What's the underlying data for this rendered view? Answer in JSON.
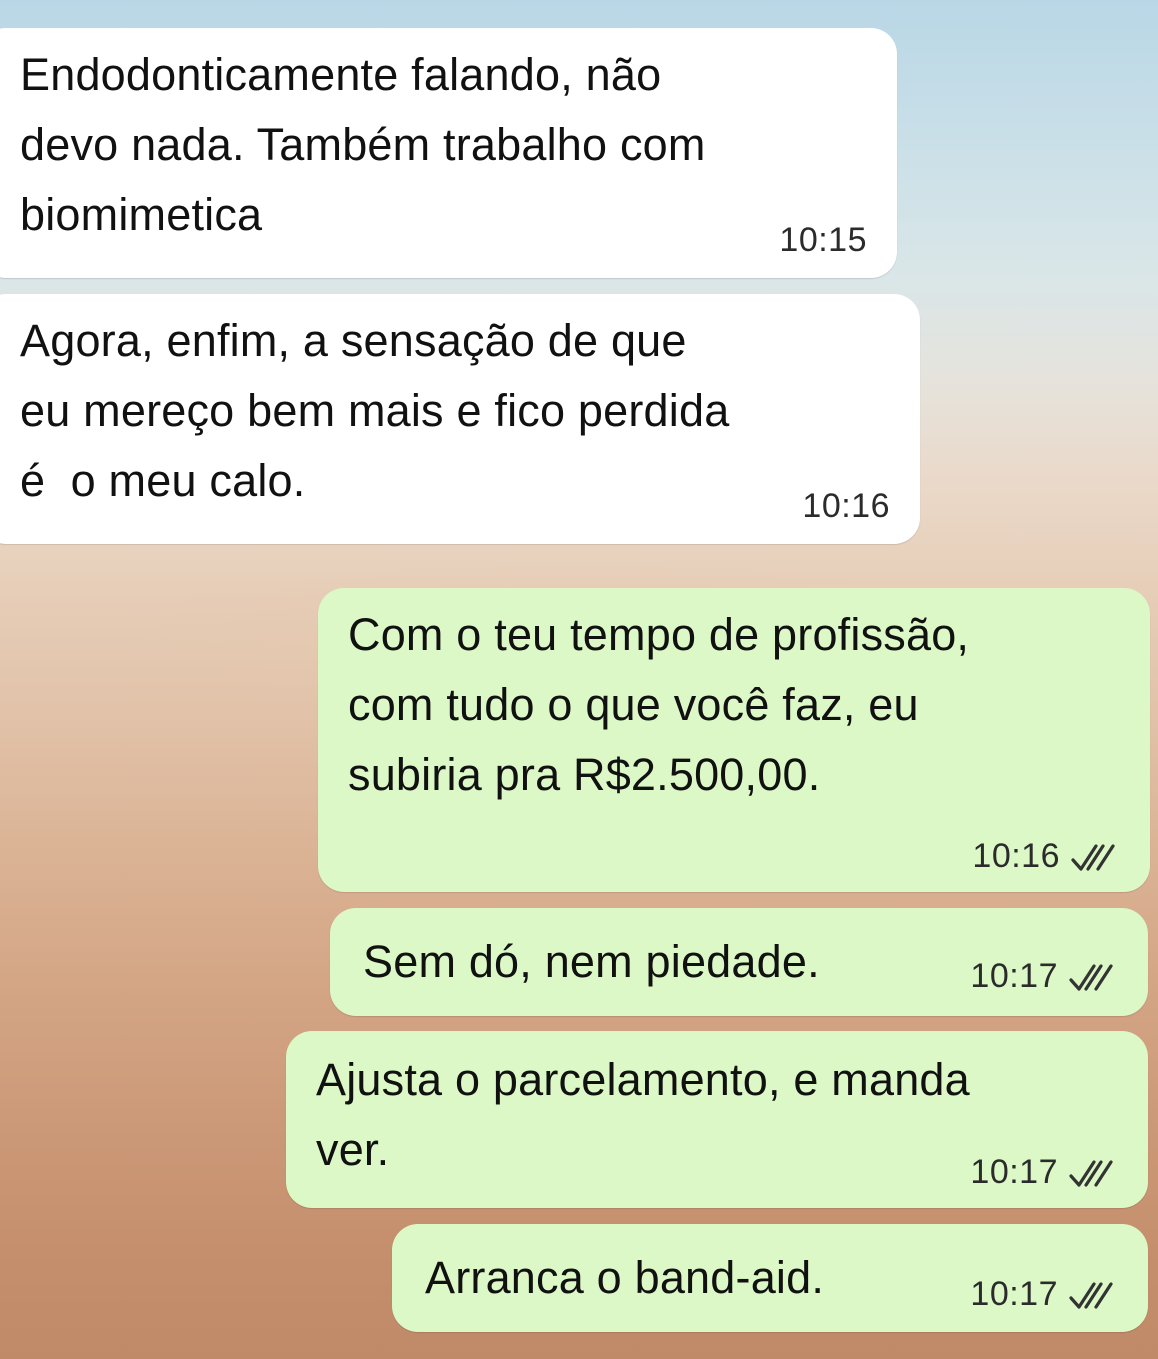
{
  "conversation": {
    "messages": [
      {
        "direction": "incoming",
        "text": "Endodonticamente falando, não\ndevo nada. Também trabalho com\nbiomimetica",
        "time": "10:15"
      },
      {
        "direction": "incoming",
        "text": "Agora, enfim, a sensação de que\neu mereço bem mais e fico perdida\né  o meu calo.",
        "time": "10:16"
      },
      {
        "direction": "outgoing",
        "text": "Com o teu tempo de profissão,\ncom tudo o que você faz, eu\nsubiria pra R$2.500,00.",
        "time": "10:16",
        "status_icon": "double-check-icon"
      },
      {
        "direction": "outgoing",
        "text": "Sem dó, nem piedade.",
        "time": "10:17",
        "status_icon": "double-check-icon"
      },
      {
        "direction": "outgoing",
        "text": "Ajusta o parcelamento, e manda\nver.",
        "time": "10:17",
        "status_icon": "double-check-icon"
      },
      {
        "direction": "outgoing",
        "text": "Arranca o band-aid.",
        "time": "10:17",
        "status_icon": "double-check-icon"
      }
    ]
  },
  "colors": {
    "incoming_bubble": "#ffffff",
    "outgoing_bubble": "#dbf8c6",
    "text": "#111111",
    "timestamp": "#2b2b2b"
  }
}
